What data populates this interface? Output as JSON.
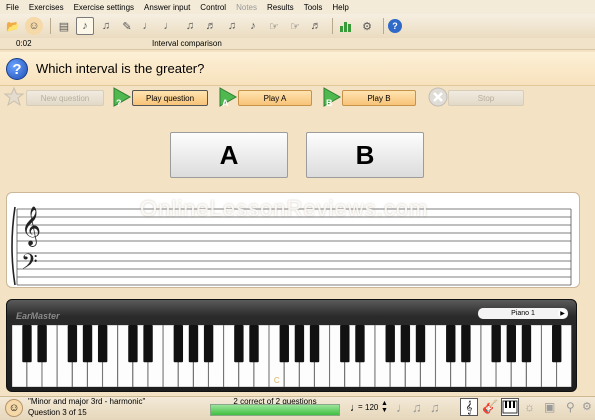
{
  "menu": [
    "File",
    "Exercises",
    "Exercise settings",
    "Answer input",
    "Control",
    "Notes",
    "Results",
    "Tools",
    "Help"
  ],
  "menu_disabled": [
    "Notes"
  ],
  "toolbar": {
    "icons": [
      "open-icon",
      "face-icon",
      "book-icon",
      "rhythm-selected-icon",
      "notes-icon",
      "dictation-icon",
      "note-icon",
      "chord-icon",
      "eighth-notes-icon",
      "keys-icon",
      "scale-icon",
      "arpeggio-icon",
      "hand-icon",
      "hand2-icon",
      "notes2-icon",
      "chart-icon",
      "settings-icon",
      "help-icon"
    ]
  },
  "info": {
    "time": "0:02",
    "exercise_title": "Interval comparison"
  },
  "question": {
    "text": "Which interval is the greater?"
  },
  "actions": {
    "new_question": "New question",
    "play_question": "Play question",
    "play_a": "Play A",
    "play_b": "Play B",
    "stop": "Stop"
  },
  "answers": {
    "a": "A",
    "b": "B"
  },
  "watermark": "OnlineLessonReviews.com",
  "keyboard": {
    "brand": "EarMaster",
    "instrument": "Piano 1",
    "octave_marker": "C"
  },
  "status": {
    "exercise_name": "\"Minor and major 3rd - harmonic\"",
    "question_counter": "Question 3 of 15",
    "score": "2 correct of 2 questions",
    "score_fraction": 1.0,
    "tempo": "120"
  },
  "colors": {
    "accent": "#2f6ac8",
    "button": "#f7c378",
    "progress": "#3fbf3f"
  }
}
